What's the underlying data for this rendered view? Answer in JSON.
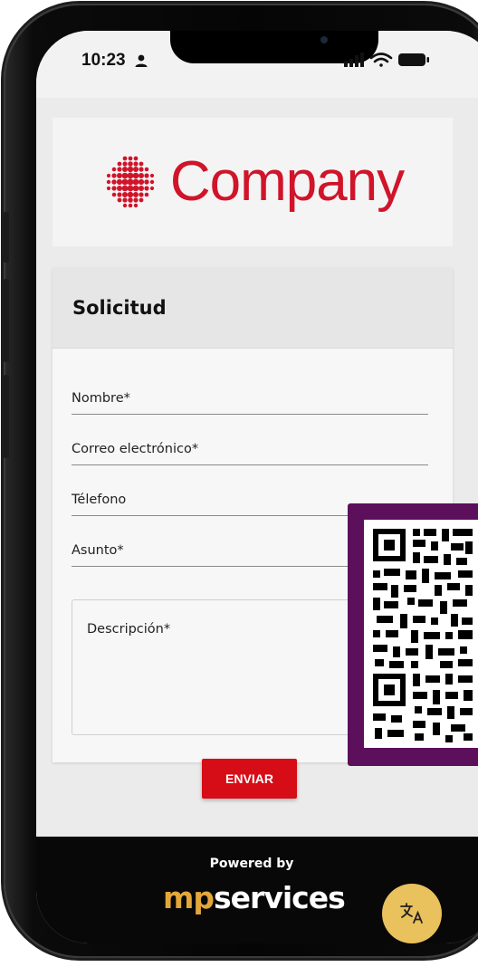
{
  "status_bar": {
    "time": "10:23"
  },
  "brand": {
    "logo_text": "Company",
    "color": "#d0142a"
  },
  "form": {
    "title": "Solicitud",
    "fields": {
      "nombre": "Nombre*",
      "correo": "Correo electrónico*",
      "telefono": "Télefono",
      "asunto": "Asunto*",
      "descripcion": "Descripción*"
    },
    "submit_label": "ENVIAR",
    "submit_color": "#d60d16"
  },
  "footer": {
    "powered_by": "Powered by",
    "brand_mp": "mp",
    "brand_services": "services",
    "translate_icon": "translate-icon"
  },
  "overlay": {
    "qr_icon": "qr-code-icon",
    "panel_color": "#5c0f5a"
  }
}
